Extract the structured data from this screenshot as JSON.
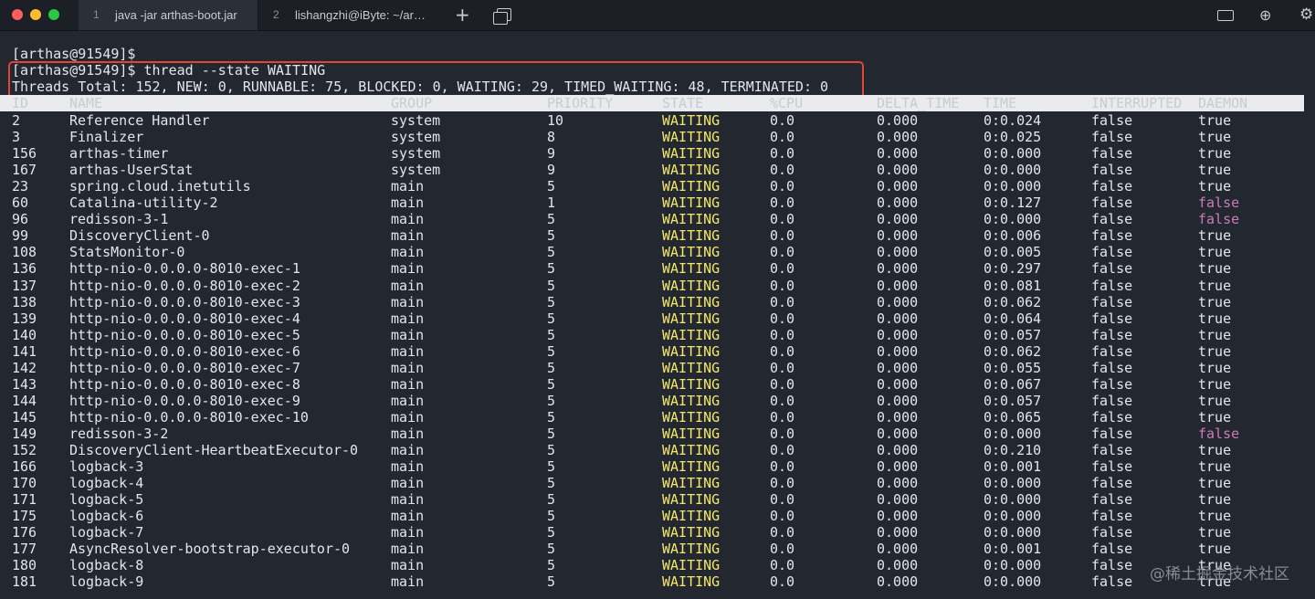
{
  "window": {
    "tabs": [
      {
        "number": "1",
        "label": "java -jar arthas-boot.jar"
      },
      {
        "number": "2",
        "label": "lishangzhi@iByte: ~/ar…"
      }
    ],
    "new_tab_icon": "plus-icon",
    "tab_overview_icon": "tab-overview-icon",
    "toolbar_icons": [
      "keyboard-icon",
      "globe-icon",
      "gear-icon"
    ]
  },
  "terminal": {
    "prompt_line": "[arthas@91549]$",
    "command_line": "[arthas@91549]$ thread --state WAITING",
    "summary_line": "Threads Total: 152, NEW: 0, RUNNABLE: 75, BLOCKED: 0, WAITING: 29, TIMED_WAITING: 48, TERMINATED: 0",
    "columns": [
      "ID",
      "NAME",
      "GROUP",
      "PRIORITY",
      "STATE",
      "%CPU",
      "DELTA_TIME",
      "TIME",
      "INTERRUPTED",
      "DAEMON"
    ],
    "rows": [
      [
        "2",
        "Reference Handler",
        "system",
        "10",
        "WAITING",
        "0.0",
        "0.000",
        "0:0.024",
        "false",
        "true"
      ],
      [
        "3",
        "Finalizer",
        "system",
        "8",
        "WAITING",
        "0.0",
        "0.000",
        "0:0.025",
        "false",
        "true"
      ],
      [
        "156",
        "arthas-timer",
        "system",
        "9",
        "WAITING",
        "0.0",
        "0.000",
        "0:0.000",
        "false",
        "true"
      ],
      [
        "167",
        "arthas-UserStat",
        "system",
        "9",
        "WAITING",
        "0.0",
        "0.000",
        "0:0.000",
        "false",
        "true"
      ],
      [
        "23",
        "spring.cloud.inetutils",
        "main",
        "5",
        "WAITING",
        "0.0",
        "0.000",
        "0:0.000",
        "false",
        "true"
      ],
      [
        "60",
        "Catalina-utility-2",
        "main",
        "1",
        "WAITING",
        "0.0",
        "0.000",
        "0:0.127",
        "false",
        "false"
      ],
      [
        "96",
        "redisson-3-1",
        "main",
        "5",
        "WAITING",
        "0.0",
        "0.000",
        "0:0.000",
        "false",
        "false"
      ],
      [
        "99",
        "DiscoveryClient-0",
        "main",
        "5",
        "WAITING",
        "0.0",
        "0.000",
        "0:0.006",
        "false",
        "true"
      ],
      [
        "108",
        "StatsMonitor-0",
        "main",
        "5",
        "WAITING",
        "0.0",
        "0.000",
        "0:0.005",
        "false",
        "true"
      ],
      [
        "136",
        "http-nio-0.0.0.0-8010-exec-1",
        "main",
        "5",
        "WAITING",
        "0.0",
        "0.000",
        "0:0.297",
        "false",
        "true"
      ],
      [
        "137",
        "http-nio-0.0.0.0-8010-exec-2",
        "main",
        "5",
        "WAITING",
        "0.0",
        "0.000",
        "0:0.081",
        "false",
        "true"
      ],
      [
        "138",
        "http-nio-0.0.0.0-8010-exec-3",
        "main",
        "5",
        "WAITING",
        "0.0",
        "0.000",
        "0:0.062",
        "false",
        "true"
      ],
      [
        "139",
        "http-nio-0.0.0.0-8010-exec-4",
        "main",
        "5",
        "WAITING",
        "0.0",
        "0.000",
        "0:0.064",
        "false",
        "true"
      ],
      [
        "140",
        "http-nio-0.0.0.0-8010-exec-5",
        "main",
        "5",
        "WAITING",
        "0.0",
        "0.000",
        "0:0.057",
        "false",
        "true"
      ],
      [
        "141",
        "http-nio-0.0.0.0-8010-exec-6",
        "main",
        "5",
        "WAITING",
        "0.0",
        "0.000",
        "0:0.062",
        "false",
        "true"
      ],
      [
        "142",
        "http-nio-0.0.0.0-8010-exec-7",
        "main",
        "5",
        "WAITING",
        "0.0",
        "0.000",
        "0:0.055",
        "false",
        "true"
      ],
      [
        "143",
        "http-nio-0.0.0.0-8010-exec-8",
        "main",
        "5",
        "WAITING",
        "0.0",
        "0.000",
        "0:0.067",
        "false",
        "true"
      ],
      [
        "144",
        "http-nio-0.0.0.0-8010-exec-9",
        "main",
        "5",
        "WAITING",
        "0.0",
        "0.000",
        "0:0.057",
        "false",
        "true"
      ],
      [
        "145",
        "http-nio-0.0.0.0-8010-exec-10",
        "main",
        "5",
        "WAITING",
        "0.0",
        "0.000",
        "0:0.065",
        "false",
        "true"
      ],
      [
        "149",
        "redisson-3-2",
        "main",
        "5",
        "WAITING",
        "0.0",
        "0.000",
        "0:0.000",
        "false",
        "false"
      ],
      [
        "152",
        "DiscoveryClient-HeartbeatExecutor-0",
        "main",
        "5",
        "WAITING",
        "0.0",
        "0.000",
        "0:0.210",
        "false",
        "true"
      ],
      [
        "166",
        "logback-3",
        "main",
        "5",
        "WAITING",
        "0.0",
        "0.000",
        "0:0.001",
        "false",
        "true"
      ],
      [
        "170",
        "logback-4",
        "main",
        "5",
        "WAITING",
        "0.0",
        "0.000",
        "0:0.000",
        "false",
        "true"
      ],
      [
        "171",
        "logback-5",
        "main",
        "5",
        "WAITING",
        "0.0",
        "0.000",
        "0:0.000",
        "false",
        "true"
      ],
      [
        "175",
        "logback-6",
        "main",
        "5",
        "WAITING",
        "0.0",
        "0.000",
        "0:0.000",
        "false",
        "true"
      ],
      [
        "176",
        "logback-7",
        "main",
        "5",
        "WAITING",
        "0.0",
        "0.000",
        "0:0.000",
        "false",
        "true"
      ],
      [
        "177",
        "AsyncResolver-bootstrap-executor-0",
        "main",
        "5",
        "WAITING",
        "0.0",
        "0.000",
        "0:0.001",
        "false",
        "true"
      ],
      [
        "180",
        "logback-8",
        "main",
        "5",
        "WAITING",
        "0.0",
        "0.000",
        "0:0.000",
        "false",
        "true"
      ],
      [
        "181",
        "logback-9",
        "main",
        "5",
        "WAITING",
        "0.0",
        "0.000",
        "0:0.000",
        "false",
        "true"
      ]
    ],
    "colors": {
      "background": "#232730",
      "state_waiting": "#f4e86c",
      "daemon_false": "#c97cb9",
      "highlight_box": "#e0443b"
    }
  },
  "watermark": "@稀土掘金技术社区"
}
